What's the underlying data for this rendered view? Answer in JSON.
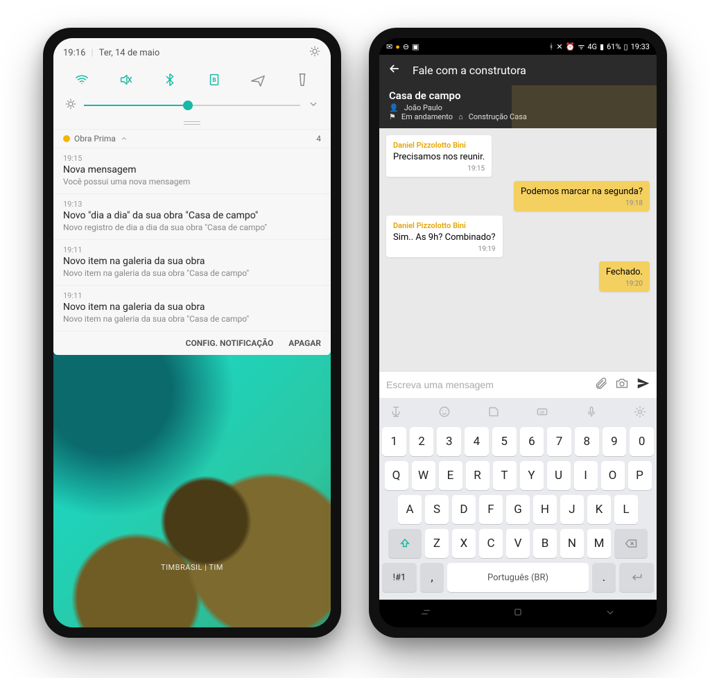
{
  "phone1": {
    "statusbar": {
      "time": "19:16",
      "date": "Ter, 14 de maio"
    },
    "group": {
      "app": "Obra Prima",
      "count": "4"
    },
    "notifications": [
      {
        "time": "19:15",
        "title": "Nova mensagem",
        "body": "Você possui uma nova mensagem"
      },
      {
        "time": "19:13",
        "title": "Novo \"dia a dia\" da sua obra \"Casa de campo\"",
        "body": "Novo registro de dia a dia da sua obra \"Casa de campo\""
      },
      {
        "time": "19:11",
        "title": "Novo item na galeria da sua obra",
        "body": "Novo item na galeria da sua obra \"Casa de campo\""
      },
      {
        "time": "19:11",
        "title": "Novo item na galeria da sua obra",
        "body": "Novo item na galeria da sua obra \"Casa de campo\""
      }
    ],
    "actions": {
      "config": "CONFIG. NOTIFICAÇÃO",
      "clear": "APAGAR"
    },
    "watermark": "TIMBRASIL | TIM"
  },
  "phone2": {
    "statusbar": {
      "battery": "61%",
      "time": "19:33",
      "net": "4G"
    },
    "appbar": {
      "title": "Fale com a construtora"
    },
    "project": {
      "name": "Casa de campo",
      "owner": "João Paulo",
      "status": "Em andamento",
      "extra": "Construção Casa"
    },
    "messages": [
      {
        "dir": "in",
        "name": "Daniel Pizzolotto Bini",
        "text": "Precisamos nos reunir.",
        "time": "19:15"
      },
      {
        "dir": "out",
        "name": "",
        "text": "Podemos marcar na segunda?",
        "time": "19:18"
      },
      {
        "dir": "in",
        "name": "Daniel Pizzolotto Bini",
        "text": "Sim.. As 9h? Combinado?",
        "time": "19:19"
      },
      {
        "dir": "out",
        "name": "",
        "text": "Fechado.",
        "time": "19:20"
      }
    ],
    "composer": {
      "placeholder": "Escreva uma mensagem"
    },
    "keyboard": {
      "numbers": [
        "1",
        "2",
        "3",
        "4",
        "5",
        "6",
        "7",
        "8",
        "9",
        "0"
      ],
      "row1": [
        "Q",
        "W",
        "E",
        "R",
        "T",
        "Y",
        "U",
        "I",
        "O",
        "P"
      ],
      "row2": [
        "A",
        "S",
        "D",
        "F",
        "G",
        "H",
        "J",
        "K",
        "L"
      ],
      "row3": [
        "Z",
        "X",
        "C",
        "V",
        "B",
        "N",
        "M"
      ],
      "space": "Português (BR)",
      "sym": "!#1",
      "comma": ",",
      "dot": "."
    }
  }
}
